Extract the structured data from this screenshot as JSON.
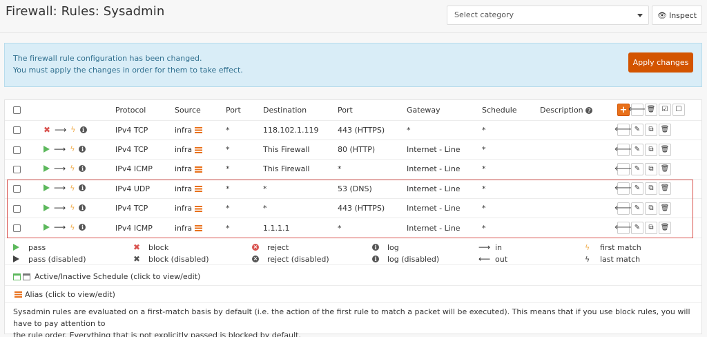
{
  "header": {
    "title": "Firewall: Rules: Sysadmin",
    "category_placeholder": "Select category",
    "inspect_label": "Inspect"
  },
  "alert": {
    "line1": "The firewall rule configuration has been changed.",
    "line2": "You must apply the changes in order for them to take effect.",
    "apply_label": "Apply changes"
  },
  "table": {
    "columns": {
      "protocol": "Protocol",
      "source": "Source",
      "port": "Port",
      "destination": "Destination",
      "dport": "Port",
      "gateway": "Gateway",
      "schedule": "Schedule",
      "description": "Description"
    },
    "rows": [
      {
        "action": "block",
        "protocol": "IPv4 TCP",
        "source": "infra",
        "sport": "*",
        "destination": "118.102.1.119",
        "dport": "443 (HTTPS)",
        "gateway": "*",
        "schedule": "*"
      },
      {
        "action": "pass",
        "protocol": "IPv4 TCP",
        "source": "infra",
        "sport": "*",
        "destination": "This Firewall",
        "dport": "80 (HTTP)",
        "gateway": "Internet - Line",
        "schedule": "*"
      },
      {
        "action": "pass",
        "protocol": "IPv4 ICMP",
        "source": "infra",
        "sport": "*",
        "destination": "This Firewall",
        "dport": "*",
        "gateway": "Internet - Line",
        "schedule": "*"
      },
      {
        "action": "pass",
        "protocol": "IPv4 UDP",
        "source": "infra",
        "sport": "*",
        "destination": "*",
        "dport": "53 (DNS)",
        "gateway": "Internet - Line",
        "schedule": "*"
      },
      {
        "action": "pass",
        "protocol": "IPv4 TCP",
        "source": "infra",
        "sport": "*",
        "destination": "*",
        "dport": "443 (HTTPS)",
        "gateway": "Internet - Line",
        "schedule": "*"
      },
      {
        "action": "pass",
        "protocol": "IPv4 ICMP",
        "source": "infra",
        "sport": "*",
        "destination": "1.1.1.1",
        "dport": "*",
        "gateway": "Internet - Line",
        "schedule": "*"
      }
    ]
  },
  "legend": {
    "pass": "pass",
    "pass_disabled": "pass (disabled)",
    "block": "block",
    "block_disabled": "block (disabled)",
    "reject": "reject",
    "reject_disabled": "reject (disabled)",
    "log": "log",
    "log_disabled": "log (disabled)",
    "in": "in",
    "out": "out",
    "first_match": "first match",
    "last_match": "last match",
    "schedule": "Active/Inactive Schedule (click to view/edit)",
    "alias": "Alias (click to view/edit)"
  },
  "footnote": {
    "line1": "Sysadmin rules are evaluated on a first-match basis by default (i.e. the action of the first rule to match a packet will be executed). This means that if you use block rules, you will have to pay attention to",
    "line2": "the rule order. Everything that is not explicitly passed is blocked by default."
  },
  "colors": {
    "accent": "#d35400",
    "pass": "#5cb85c",
    "block": "#d9534f",
    "alert_bg": "#d9edf7"
  }
}
